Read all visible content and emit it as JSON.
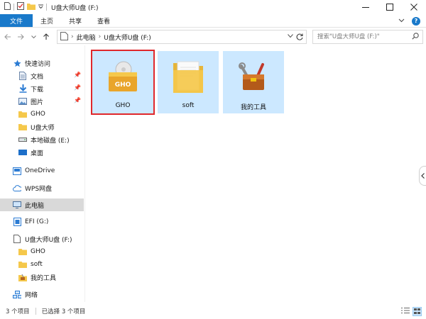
{
  "window": {
    "title": "U盘大师U盘 (F:)"
  },
  "ribbon": {
    "tabs": [
      "文件",
      "主页",
      "共享",
      "查看"
    ],
    "help_glyph": "?"
  },
  "address": {
    "crumbs": [
      "此电脑",
      "U盘大师U盘 (F:)"
    ],
    "search_placeholder": "搜索\"U盘大师U盘 (F:)\""
  },
  "nav": {
    "items": [
      {
        "label": "快速访问",
        "icon": "star-icon",
        "level": 0
      },
      {
        "label": "文档",
        "icon": "document-icon",
        "level": 1,
        "pinned": true
      },
      {
        "label": "下载",
        "icon": "download-icon",
        "level": 1,
        "pinned": true
      },
      {
        "label": "图片",
        "icon": "picture-icon",
        "level": 1,
        "pinned": true
      },
      {
        "label": "GHO",
        "icon": "folder-icon",
        "level": 1
      },
      {
        "label": "U盘大师",
        "icon": "folder-icon",
        "level": 1
      },
      {
        "label": "本地磁盘 (E:)",
        "icon": "drive-icon",
        "level": 1
      },
      {
        "label": "桌面",
        "icon": "desktop-icon",
        "level": 1
      },
      {
        "label": "OneDrive",
        "icon": "onedrive-icon",
        "level": 0
      },
      {
        "label": "WPS网盘",
        "icon": "cloud-icon",
        "level": 0
      },
      {
        "label": "此电脑",
        "icon": "computer-icon",
        "level": 0,
        "selected": true
      },
      {
        "label": "EFI (G:)",
        "icon": "efi-drive-icon",
        "level": 0
      },
      {
        "label": "U盘大师U盘 (F:)",
        "icon": "usb-drive-icon",
        "level": 0
      },
      {
        "label": "GHO",
        "icon": "folder-icon",
        "level": 1
      },
      {
        "label": "soft",
        "icon": "folder-icon",
        "level": 1
      },
      {
        "label": "我的工具",
        "icon": "toolbox-folder-icon",
        "level": 1
      },
      {
        "label": "网络",
        "icon": "network-icon",
        "level": 0
      }
    ]
  },
  "content": {
    "items": [
      {
        "label": "GHO",
        "icon": "gho-folder-icon"
      },
      {
        "label": "soft",
        "icon": "folder-icon"
      },
      {
        "label": "我的工具",
        "icon": "toolbox-folder-icon"
      }
    ]
  },
  "status": {
    "count": "3 个项目",
    "selected": "已选择 3 个项目"
  },
  "colors": {
    "accent": "#1979ca",
    "selection": "#cce8ff",
    "focus_border": "#e0272b",
    "folder": "#f5c84b"
  }
}
